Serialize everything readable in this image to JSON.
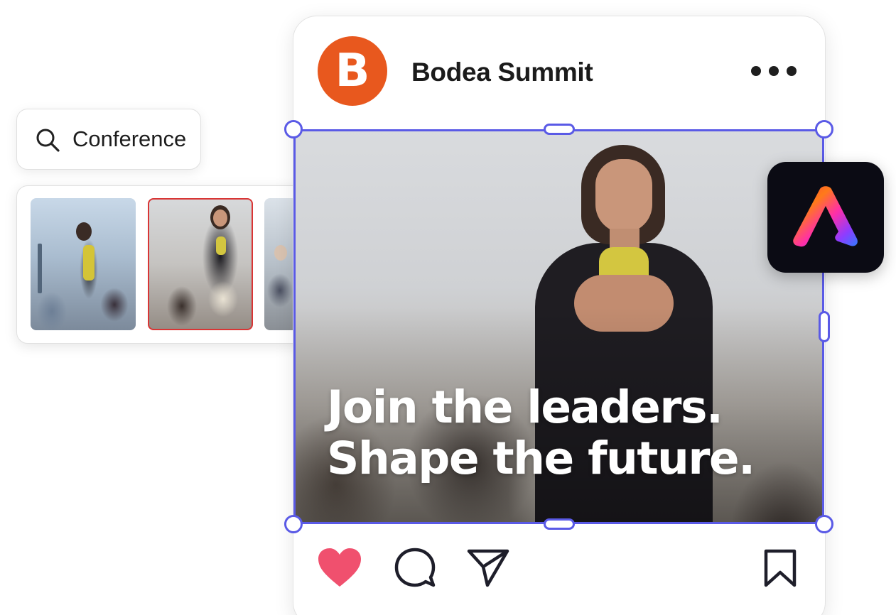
{
  "search": {
    "query": "Conference"
  },
  "thumbnails": [
    {
      "name": "conference-photo-1",
      "selected": false
    },
    {
      "name": "conference-photo-2",
      "selected": true
    },
    {
      "name": "conference-photo-3",
      "selected": false
    }
  ],
  "post": {
    "account_initial": "B",
    "account_name": "Bodea Summit",
    "headline_line1": "Join the leaders.",
    "headline_line2": "Shape the future.",
    "liked": true
  },
  "app_icon": {
    "name": "adobe-express-icon"
  },
  "icons": [
    "search-icon",
    "more-icon",
    "heart-icon",
    "comment-icon",
    "share-icon",
    "bookmark-icon",
    "adobe-express-icon"
  ],
  "colors": {
    "avatar": "#e8581e",
    "selection": "#5a5ae6",
    "heart": "#f0506e",
    "thumb_selected_border": "#d93535",
    "app_icon_bg": "#0b0b14"
  }
}
